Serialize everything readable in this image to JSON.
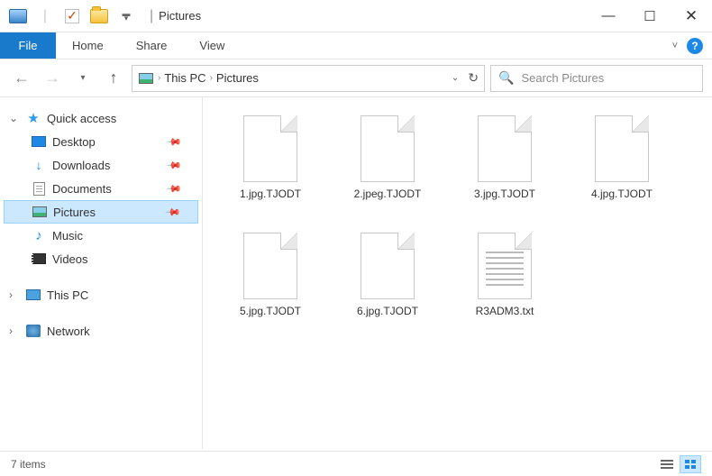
{
  "title": "Pictures",
  "ribbon": {
    "file": "File",
    "tabs": [
      "Home",
      "Share",
      "View"
    ]
  },
  "breadcrumb": {
    "items": [
      "This PC",
      "Pictures"
    ]
  },
  "search": {
    "placeholder": "Search Pictures"
  },
  "sidebar": {
    "quick_access": "Quick access",
    "items": [
      {
        "label": "Desktop",
        "pinned": true
      },
      {
        "label": "Downloads",
        "pinned": true
      },
      {
        "label": "Documents",
        "pinned": true
      },
      {
        "label": "Pictures",
        "pinned": true,
        "selected": true
      },
      {
        "label": "Music",
        "pinned": false
      },
      {
        "label": "Videos",
        "pinned": false
      }
    ],
    "this_pc": "This PC",
    "network": "Network"
  },
  "files": [
    {
      "name": "1.jpg.TJODT",
      "type": "blank"
    },
    {
      "name": "2.jpeg.TJODT",
      "type": "blank"
    },
    {
      "name": "3.jpg.TJODT",
      "type": "blank"
    },
    {
      "name": "4.jpg.TJODT",
      "type": "blank"
    },
    {
      "name": "5.jpg.TJODT",
      "type": "blank"
    },
    {
      "name": "6.jpg.TJODT",
      "type": "blank"
    },
    {
      "name": "R3ADM3.txt",
      "type": "txt"
    }
  ],
  "status": {
    "count": "7 items"
  }
}
